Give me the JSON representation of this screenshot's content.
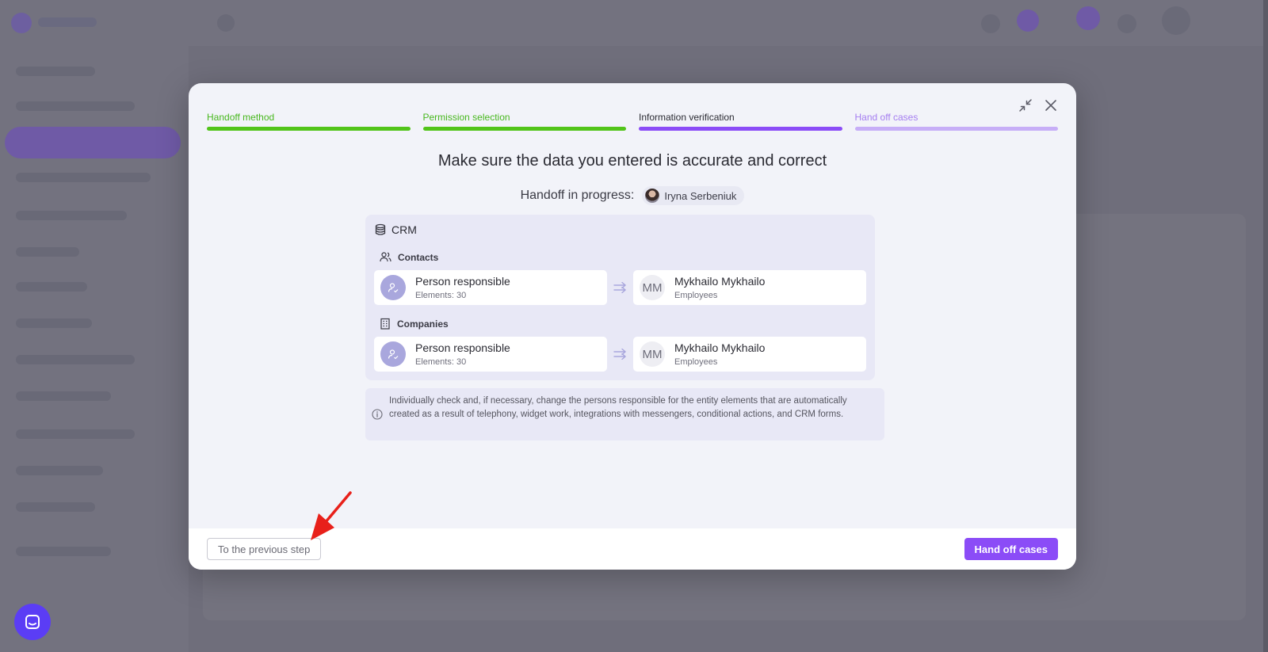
{
  "colors": {
    "accent": "#8b4cf7",
    "step_done": "#52c41a",
    "step_next": "#c7aef7",
    "overlay": "#6f6e7b",
    "annotation": "#e8201a",
    "chat_launcher": "#5b3df5"
  },
  "modal": {
    "steps": [
      {
        "label": "Handoff method",
        "state": "done"
      },
      {
        "label": "Permission selection",
        "state": "done"
      },
      {
        "label": "Information verification",
        "state": "current"
      },
      {
        "label": "Hand off cases",
        "state": "next"
      }
    ],
    "title": "Make sure the data you entered is accurate and correct",
    "progress_label": "Handoff in progress:",
    "user_name": "Iryna Serbeniuk",
    "crm": {
      "title": "CRM",
      "groups": [
        {
          "title": "Contacts",
          "icon": "users-icon",
          "from": {
            "title": "Person responsible",
            "subtitle": "Elements: 30"
          },
          "to": {
            "initials": "MM",
            "name": "Mykhailo Mykhailo",
            "subtitle": "Employees"
          }
        },
        {
          "title": "Companies",
          "icon": "building-icon",
          "from": {
            "title": "Person responsible",
            "subtitle": "Elements: 30"
          },
          "to": {
            "initials": "MM",
            "name": "Mykhailo Mykhailo",
            "subtitle": "Employees"
          }
        }
      ]
    },
    "info_text": "Individually check and, if necessary, change the persons responsible for the entity elements that are automatically created as a result of telephony, widget work, integrations with messengers, conditional actions, and CRM forms.",
    "footer": {
      "prev_button": "To the previous step",
      "primary_button": "Hand off cases"
    }
  },
  "icons": {
    "minimize": "collapse-icon",
    "close": "close-icon",
    "crm": "database-icon",
    "transfer": "transfer-arrow-icon",
    "info": "info-icon",
    "chat": "chat-icon"
  }
}
